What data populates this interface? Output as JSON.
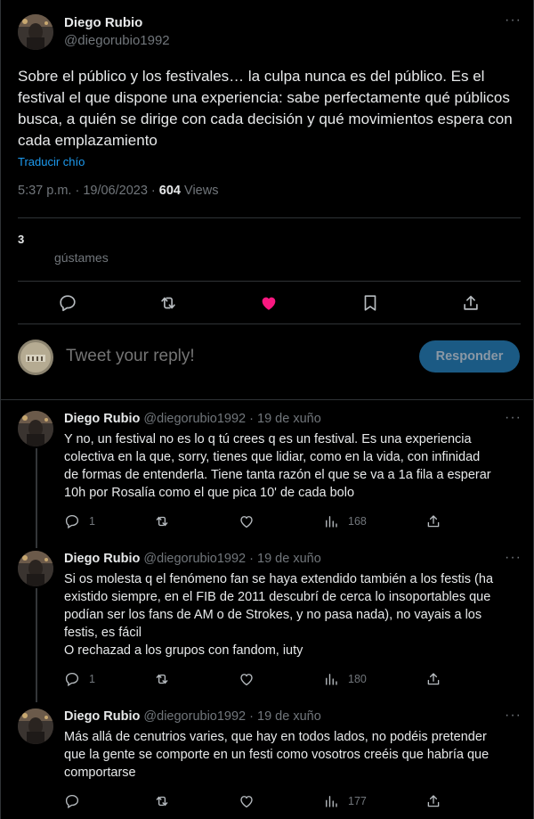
{
  "main_tweet": {
    "author_name": "Diego Rubio",
    "author_handle": "@diegorubio1992",
    "text": "Sobre el público y los festivales… la culpa nunca es del público. Es el festival el que dispone una experiencia: sabe perfectamente qué públicos busca, a quién se dirige con cada decisión y qué movimientos espera con cada emplazamiento",
    "translate_label": "Traducir chío",
    "time_date": "5:37 p.m. · 19/06/2023 · ",
    "views_count": "604",
    "views_label": "Views",
    "likes_count": "3",
    "likes_label": "gústames",
    "more_label": "···"
  },
  "reply_box": {
    "placeholder": "Tweet your reply!",
    "button_label": "Responder"
  },
  "replies": [
    {
      "author_name": "Diego Rubio",
      "author_meta": "@diegorubio1992 · 19 de xuño",
      "lines": [
        "Y no, un festival no es lo q tú crees q es un festival. Es una experiencia",
        "colectiva en la que, sorry, tienes que lidiar, como en la vida, con infinidad",
        "de formas de entenderla. Tiene tanta razón el que se va a 1a fila a esperar",
        "10h por Rosalía como el que pica 10' de cada bolo"
      ],
      "reply_count": "1",
      "views_count": "168"
    },
    {
      "author_name": "Diego Rubio",
      "author_meta": "@diegorubio1992 · 19 de xuño",
      "lines": [
        "Si os molesta q el fenómeno fan se haya extendido también a los festis (ha",
        "existido siempre, en el FIB de 2011 descubrí de cerca lo insoportables que",
        "podían ser los fans de AM o de Strokes, y no pasa nada), no vayais a los",
        "festis, es fácil",
        "O rechazad a los grupos con fandom, iuty"
      ],
      "reply_count": "1",
      "views_count": "180"
    },
    {
      "author_name": "Diego Rubio",
      "author_meta": "@diegorubio1992 · 19 de xuño",
      "lines": [
        "Más allá de cenutrios varies, que hay en todos lados, no podéis pretender",
        "que la gente se comporte en un festi como vosotros creéis que habría que",
        "comportarse"
      ],
      "reply_count": "",
      "views_count": "177"
    }
  ],
  "colors": {
    "background": "#000000",
    "text": "#e7e9ea",
    "muted": "#71767b",
    "link": "#1d9bf0",
    "like_active": "#f91880",
    "button": "#1b5a84"
  }
}
